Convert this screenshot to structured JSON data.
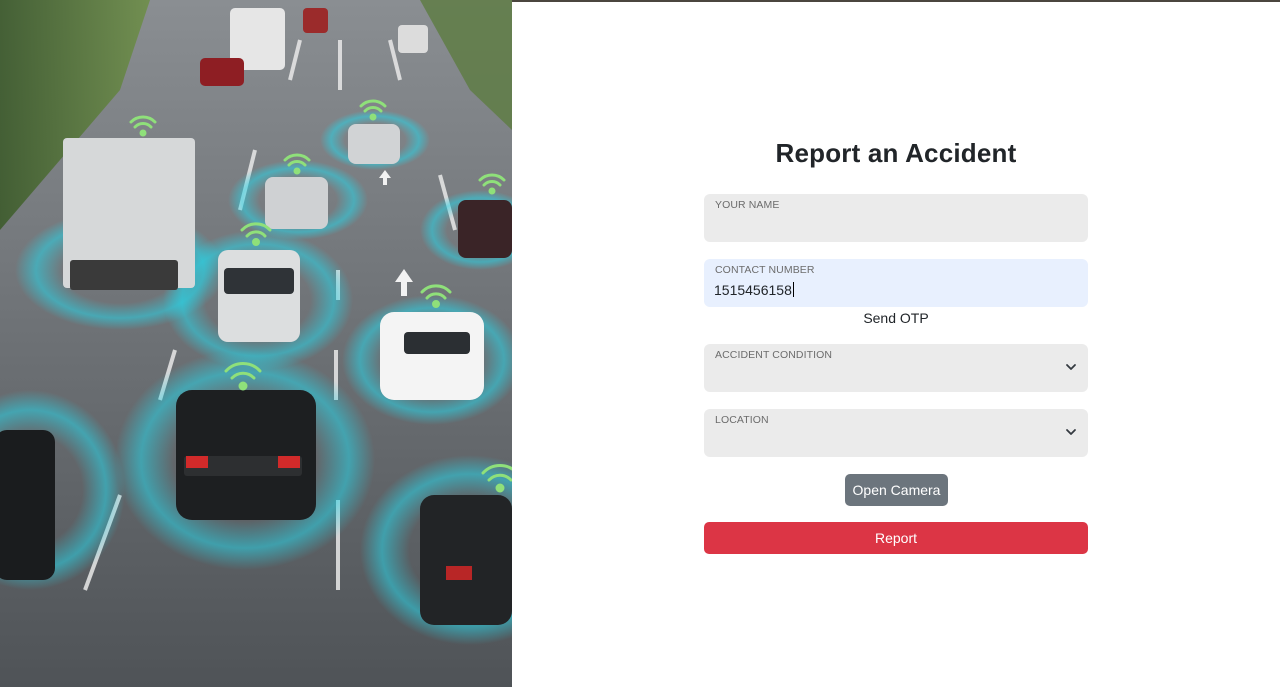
{
  "form": {
    "title": "Report an Accident",
    "name_field": {
      "label": "YOUR NAME",
      "value": ""
    },
    "contact_field": {
      "label": "CONTACT NUMBER",
      "value": "1515456158"
    },
    "send_otp_label": "Send OTP",
    "condition_field": {
      "label": "ACCIDENT CONDITION",
      "value": ""
    },
    "location_field": {
      "label": "LOCATION",
      "value": ""
    },
    "open_camera_label": "Open Camera",
    "report_label": "Report"
  },
  "colors": {
    "report_button": "#dc3545",
    "camera_button": "#6c757d",
    "input_bg": "#ebebeb",
    "input_active_bg": "#e8f0fe",
    "sensor_glow": "#29d3e6",
    "signal_icon": "#8fe07a"
  }
}
